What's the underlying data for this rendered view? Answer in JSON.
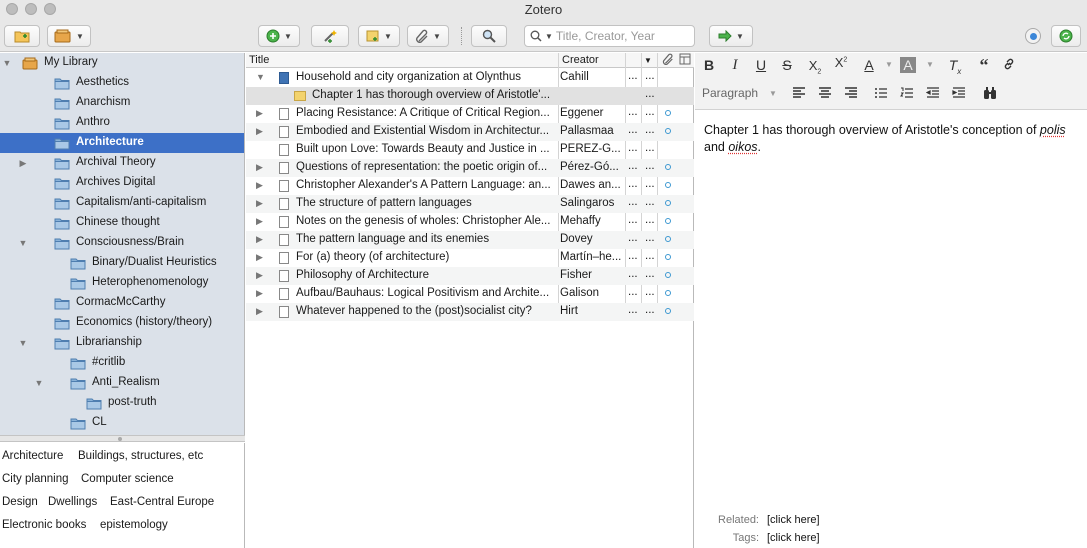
{
  "window": {
    "title": "Zotero"
  },
  "toolbar": {
    "search_placeholder": "Title, Creator, Year"
  },
  "collections": [
    {
      "label": "My Library",
      "level": 0,
      "twisty": "open",
      "root": true
    },
    {
      "label": "Aesthetics",
      "level": 1
    },
    {
      "label": "Anarchism",
      "level": 1
    },
    {
      "label": "Anthro",
      "level": 1
    },
    {
      "label": "Architecture",
      "level": 1,
      "selected": true
    },
    {
      "label": "Archival Theory",
      "level": 1,
      "twisty": "closed"
    },
    {
      "label": "Archives Digital",
      "level": 1
    },
    {
      "label": "Capitalism/anti-capitalism",
      "level": 1
    },
    {
      "label": "Chinese thought",
      "level": 1
    },
    {
      "label": "Consciousness/Brain",
      "level": 1,
      "twisty": "open"
    },
    {
      "label": "Binary/Dualist Heuristics",
      "level": 2
    },
    {
      "label": "Heterophenomenology",
      "level": 2
    },
    {
      "label": "CormacMcCarthy",
      "level": 1
    },
    {
      "label": "Economics (history/theory)",
      "level": 1
    },
    {
      "label": "Librarianship",
      "level": 1,
      "twisty": "open"
    },
    {
      "label": "#critlib",
      "level": 2
    },
    {
      "label": "Anti_Realism",
      "level": 2,
      "twisty": "open"
    },
    {
      "label": "post-truth",
      "level": 3
    },
    {
      "label": "CL",
      "level": 2
    }
  ],
  "tags": [
    [
      "Architecture",
      "Buildings, structures, etc"
    ],
    [
      "City planning",
      "Computer science"
    ],
    [
      "Design",
      "Dwellings",
      "East-Central Europe"
    ],
    [
      "Electronic books",
      "epistemology"
    ]
  ],
  "items_header": {
    "title": "Title",
    "creator": "Creator"
  },
  "items": [
    {
      "title": "Household and city organization at Olynthus",
      "creator": "Cahill",
      "type": "book",
      "twisty": "open",
      "attach": false
    },
    {
      "title": "Chapter 1 has thorough overview of Aristotle'...",
      "creator": "",
      "type": "note",
      "child": true,
      "selected": true,
      "attach": false
    },
    {
      "title": "Placing Resistance: A Critique of Critical Region...",
      "creator": "Eggener",
      "type": "doc",
      "twisty": "closed",
      "attach": true
    },
    {
      "title": "Embodied and Existential Wisdom in Architectur...",
      "creator": "Pallasmaa",
      "type": "doc",
      "twisty": "closed",
      "attach": true
    },
    {
      "title": "Built upon Love: Towards Beauty and Justice in ...",
      "creator": "PÉREZ-G...",
      "type": "doc",
      "twisty": "none",
      "attach": false
    },
    {
      "title": "Questions of representation: the poetic origin of...",
      "creator": "Pérez-Gó...",
      "type": "doc",
      "twisty": "closed",
      "attach": true
    },
    {
      "title": "Christopher Alexander's A Pattern Language: an...",
      "creator": "Dawes an...",
      "type": "doc",
      "twisty": "closed",
      "attach": true
    },
    {
      "title": "The structure of pattern languages",
      "creator": "Salingaros",
      "type": "doc",
      "twisty": "closed",
      "attach": true
    },
    {
      "title": "Notes on the genesis of wholes: Christopher Ale...",
      "creator": "Mehaffy",
      "type": "doc",
      "twisty": "closed",
      "attach": true
    },
    {
      "title": "The pattern language and its enemies",
      "creator": "Dovey",
      "type": "doc",
      "twisty": "closed",
      "attach": true
    },
    {
      "title": "For (a) theory (of architecture)",
      "creator": "Martín–he...",
      "type": "doc",
      "twisty": "closed",
      "attach": true
    },
    {
      "title": "Philosophy of Architecture",
      "creator": "Fisher",
      "type": "doc",
      "twisty": "closed",
      "attach": true
    },
    {
      "title": "Aufbau/Bauhaus: Logical Positivism and Archite...",
      "creator": "Galison",
      "type": "doc",
      "twisty": "closed",
      "attach": true
    },
    {
      "title": "Whatever happened to the (post)socialist city?",
      "creator": "Hirt",
      "type": "doc",
      "twisty": "closed",
      "attach": true
    }
  ],
  "note": {
    "paragraph_style": "Paragraph",
    "text_before": "Chapter 1 has thorough overview of Aristotle's conception of ",
    "em1": "polis",
    "mid": " and ",
    "em2": "oikos",
    "end": ".",
    "related_label": "Related:",
    "related_value": "[click here]",
    "tags_label": "Tags:",
    "tags_value": "[click here]"
  },
  "colors": {
    "selection": "#3d70c7",
    "sidebar": "#dbe1e9",
    "attachment": "#3d98d1"
  }
}
